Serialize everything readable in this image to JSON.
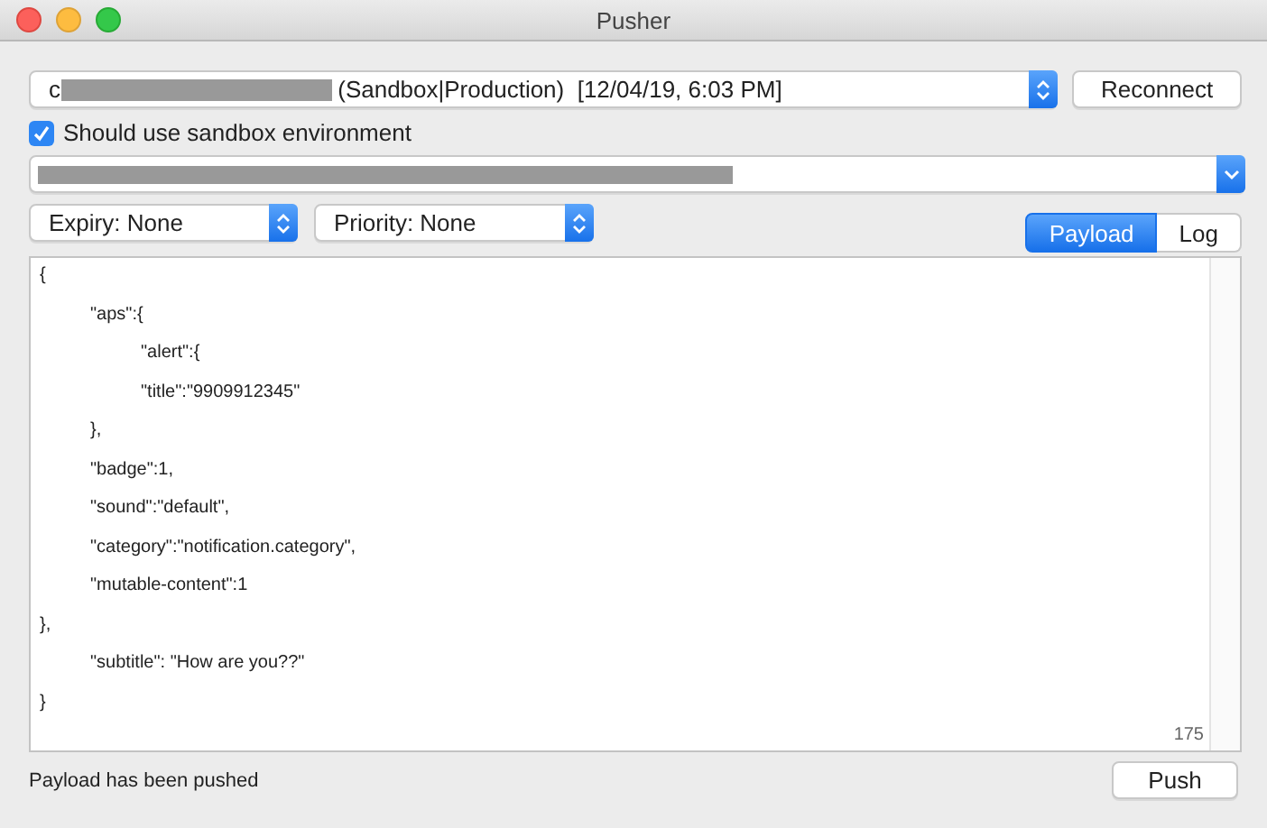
{
  "window": {
    "title": "Pusher"
  },
  "identity": {
    "prefix": "c",
    "redacted": true,
    "suffix": "(Sandbox|Production)  [12/04/19, 6:03 PM]"
  },
  "reconnect_button": "Reconnect",
  "sandbox_checkbox": {
    "label": "Should use sandbox environment",
    "checked": true
  },
  "device_token": {
    "redacted": true
  },
  "expiry": "Expiry: None",
  "priority": "Priority: None",
  "tabs": [
    {
      "label": "Payload",
      "selected": true
    },
    {
      "label": "Log",
      "selected": false
    }
  ],
  "payload_lines": [
    "{",
    "\t\"aps\":{",
    "\t\t\"alert\":{",
    "\t\t\"title\":\"9909912345\"",
    "\t},",
    "\t\"badge\":1,",
    "\t\"sound\":\"default\",",
    "\t\"category\":\"notification.category\",",
    "\t\"mutable-content\":1",
    "},",
    "\t\"subtitle\": \"How are you??\"",
    "}"
  ],
  "character_count": "175",
  "status": "Payload has been pushed",
  "push_button": "Push"
}
